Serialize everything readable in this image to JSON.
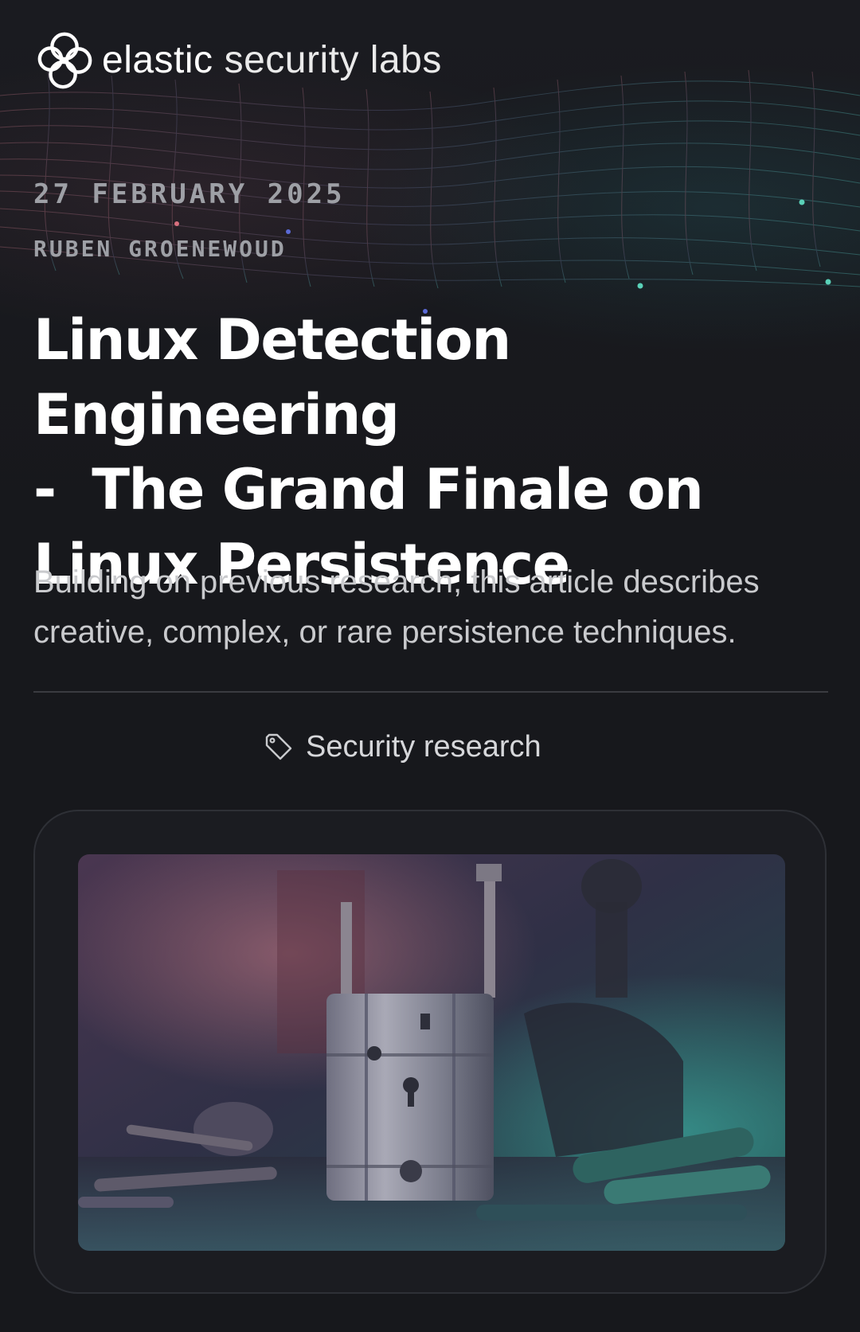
{
  "header": {
    "brand_primary": "elastic",
    "brand_secondary": "security labs",
    "logo_icon": "elastic-logo-icon"
  },
  "article": {
    "date": "27 FEBRUARY 2025",
    "author": "RUBEN GROENEWOUD",
    "title_lines": [
      "Linux Detection Engineering",
      "-  The Grand Finale on",
      "Linux Persistence"
    ],
    "subtitle": "Building on previous research, this article describes creative, complex, or rare persistence techniques.",
    "tag": {
      "icon": "tag-icon",
      "label": "Security research"
    },
    "hero_image": {
      "icon": "hero-image"
    }
  },
  "colors": {
    "background": "#17181c",
    "text_primary": "#ffffff",
    "text_secondary": "#c9cacd",
    "meta_gray": "#9ea0a6",
    "accent_teal": "#5ad1b8",
    "accent_pink": "#d8707e"
  }
}
